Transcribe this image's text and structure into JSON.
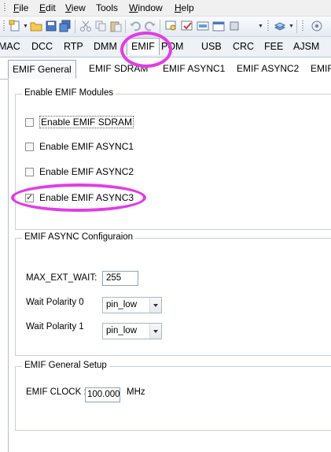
{
  "menu": {
    "items": [
      {
        "label": "File",
        "mnemonic": "F"
      },
      {
        "label": "Edit",
        "mnemonic": "E"
      },
      {
        "label": "View",
        "mnemonic": "V"
      },
      {
        "label": "Tools",
        "mnemonic": ""
      },
      {
        "label": "Window",
        "mnemonic": "W"
      },
      {
        "label": "Help",
        "mnemonic": "H"
      }
    ]
  },
  "toolbar": {
    "icons": [
      "new-file-icon",
      "open-folder-icon",
      "save-icon",
      "save-all-icon",
      "cut-icon",
      "copy-icon",
      "paste-icon",
      "undo-icon",
      "redo-icon",
      "search-code-icon",
      "check-code-icon",
      "build-icon",
      "debug-icon",
      "layers-icon",
      "settings-icon"
    ]
  },
  "module_tabs": [
    {
      "label": "MAC"
    },
    {
      "label": "DCC"
    },
    {
      "label": "RTP"
    },
    {
      "label": "DMM"
    },
    {
      "label": "EMIF",
      "active": true
    },
    {
      "label": "POM"
    },
    {
      "label": "USB"
    },
    {
      "label": "CRC"
    },
    {
      "label": "FEE"
    },
    {
      "label": "AJSM"
    }
  ],
  "sub_tabs": [
    {
      "label": "EMIF General",
      "active": true
    },
    {
      "label": "EMIF SDRAM"
    },
    {
      "label": "EMIF ASYNC1"
    },
    {
      "label": "EMIF ASYNC2"
    },
    {
      "label": "EMIF"
    }
  ],
  "enable_group": {
    "title": "Enable EMIF Modules",
    "checkboxes": [
      {
        "label": "Enable EMIF SDRAM",
        "checked": false,
        "focused": true
      },
      {
        "label": "Enable EMIF ASYNC1",
        "checked": false
      },
      {
        "label": "Enable EMIF ASYNC2",
        "checked": false
      },
      {
        "label": "Enable EMIF ASYNC3",
        "checked": true
      }
    ]
  },
  "async_group": {
    "title": "EMIF ASYNC Configuraion",
    "max_ext_wait": {
      "label": "MAX_EXT_WAIT:",
      "value": "255"
    },
    "wait_polarity_0": {
      "label": "Wait Polarity 0",
      "value": "pin_low"
    },
    "wait_polarity_1": {
      "label": "Wait Polarity 1",
      "value": "pin_low"
    }
  },
  "general_group": {
    "title": "EMIF General Setup",
    "clock": {
      "label": "EMIF CLOCK :",
      "value": "100.000",
      "unit": "MHz"
    }
  },
  "colors": {
    "annotation": "#e23ce6",
    "tab_border": "#9aa8bb"
  }
}
